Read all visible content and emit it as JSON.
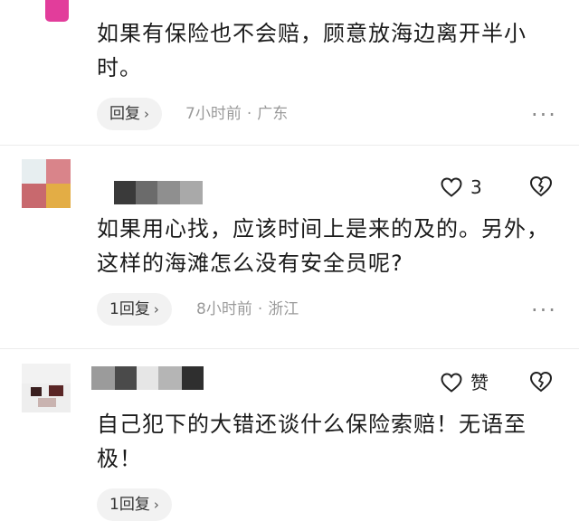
{
  "comments": [
    {
      "text": "如果有保险也不会赔，顾意放海边离开半小时。",
      "reply_label": "回复",
      "time": "7小时前",
      "location": "广东"
    },
    {
      "text": "如果用心找，应该时间上是来的及的。另外，这样的海滩怎么没有安全员呢?",
      "like_count": "3",
      "reply_label": "1回复",
      "time": "8小时前",
      "location": "浙江"
    },
    {
      "text": "自己犯下的大错还谈什么保险索赔！无语至极！",
      "like_label": "赞",
      "reply_label": "1回复"
    }
  ],
  "separator": "·",
  "more_glyph": "···",
  "reply_chevron": "›",
  "colors": {
    "accent_avatar": "#e23d9b",
    "meta_text": "#9a9a9a",
    "reply_bg": "#f2f2f2"
  },
  "icons": [
    "heart-icon",
    "broken-heart-icon",
    "more-icon",
    "chevron-right-icon"
  ]
}
